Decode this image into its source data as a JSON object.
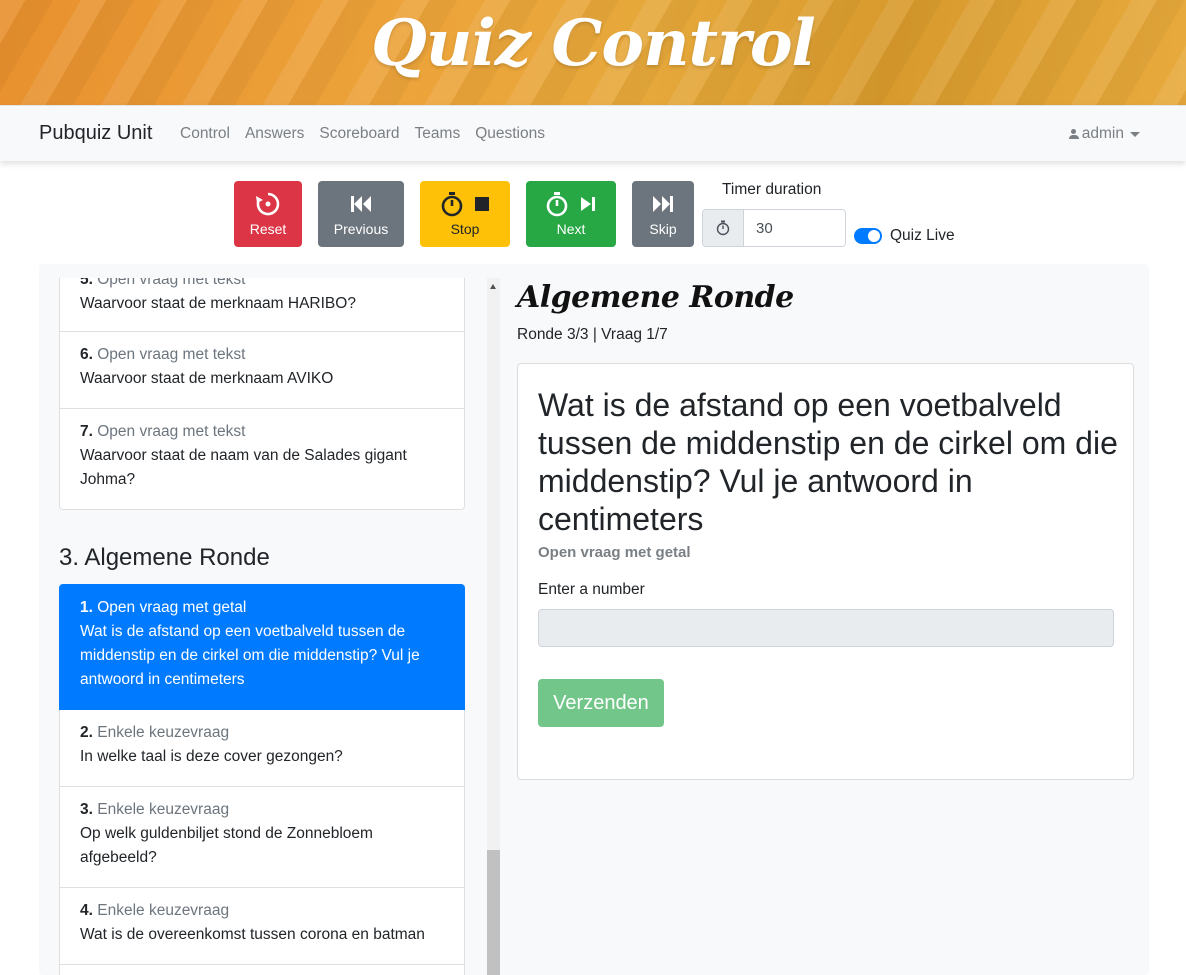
{
  "banner": {
    "title": "Quiz Control"
  },
  "navbar": {
    "brand": "Pubquiz Unit",
    "links": [
      "Control",
      "Answers",
      "Scoreboard",
      "Teams",
      "Questions"
    ],
    "user": "admin"
  },
  "controls": {
    "reset": "Reset",
    "previous": "Previous",
    "stop": "Stop",
    "next": "Next",
    "skip": "Skip",
    "timer_label": "Timer duration",
    "timer_value": "30",
    "live_label": "Quiz Live",
    "live_on": true
  },
  "question_list": {
    "previous_round_items": [
      {
        "num": "5.",
        "type": "Open vraag met tekst",
        "text": "Waarvoor staat de merknaam HARIBO?"
      },
      {
        "num": "6.",
        "type": "Open vraag met tekst",
        "text": "Waarvoor staat de merknaam AVIKO"
      },
      {
        "num": "7.",
        "type": "Open vraag met tekst",
        "text": "Waarvoor staat de naam van de Salades gigant Johma?"
      }
    ],
    "section_title": "3. Algemene Ronde",
    "items": [
      {
        "num": "1.",
        "type": "Open vraag met getal",
        "text": "Wat is de afstand op een voetbalveld tussen de middenstip en de cirkel om die middenstip? Vul je antwoord in centimeters",
        "active": true
      },
      {
        "num": "2.",
        "type": "Enkele keuzevraag",
        "text": "In welke taal is deze cover gezongen?"
      },
      {
        "num": "3.",
        "type": "Enkele keuzevraag",
        "text": "Op welk guldenbiljet stond de Zonnebloem afgebeeld?"
      },
      {
        "num": "4.",
        "type": "Enkele keuzevraag",
        "text": "Wat is de overeenkomst tussen corona en batman"
      }
    ]
  },
  "current": {
    "round_title": "Algemene Ronde",
    "round_info": "Ronde 3/3 | Vraag 1/7",
    "question": "Wat is de afstand op een voetbalveld tussen de middenstip en de cirkel om die middenstip? Vul je antwoord in centimeters",
    "question_type": "Open vraag met getal",
    "input_label": "Enter a number",
    "input_value": "",
    "submit_label": "Verzenden"
  },
  "colors": {
    "reset": "#dc3545",
    "secondary": "#6c757d",
    "stop": "#ffc107",
    "next": "#28a745",
    "active": "#007bff",
    "submit": "#73c68a"
  }
}
